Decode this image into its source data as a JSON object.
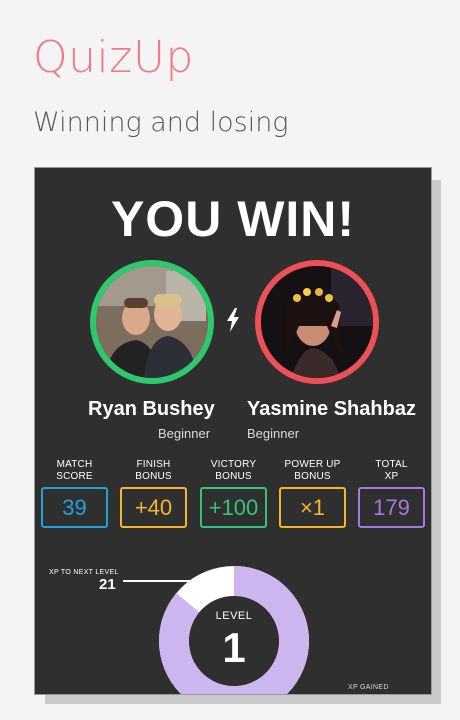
{
  "app": {
    "title": "QuizUp",
    "subtitle": "Winning and losing"
  },
  "result": {
    "headline": "YOU WIN!"
  },
  "players": [
    {
      "name": "Ryan Bushey",
      "level": "Beginner",
      "ring_color": "#2ec86f"
    },
    {
      "name": "Yasmine Shahbaz",
      "level": "Beginner",
      "ring_color": "#ef4f56"
    }
  ],
  "stats": [
    {
      "label_line1": "MATCH",
      "label_line2": "SCORE",
      "value": "39",
      "color": "#1ea3dd"
    },
    {
      "label_line1": "FINISH",
      "label_line2": "BONUS",
      "value": "+40",
      "color": "#f4b52d"
    },
    {
      "label_line1": "VICTORY",
      "label_line2": "BONUS",
      "value": "+100",
      "color": "#2fc67a"
    },
    {
      "label_line1": "POWER UP",
      "label_line2": "BONUS",
      "value": "×1",
      "color": "#f4b52d"
    },
    {
      "label_line1": "TOTAL",
      "label_line2": "XP",
      "value": "179",
      "color": "#a877e0"
    }
  ],
  "progress": {
    "xp_to_next_label": "XP TO NEXT LEVEL",
    "xp_to_next_value": "21",
    "level_label": "LEVEL",
    "level_value": "1",
    "level_progress_fraction": 0.86,
    "ring_color": "#cdb5ef",
    "xp_gained_label": "XP GAINED"
  }
}
